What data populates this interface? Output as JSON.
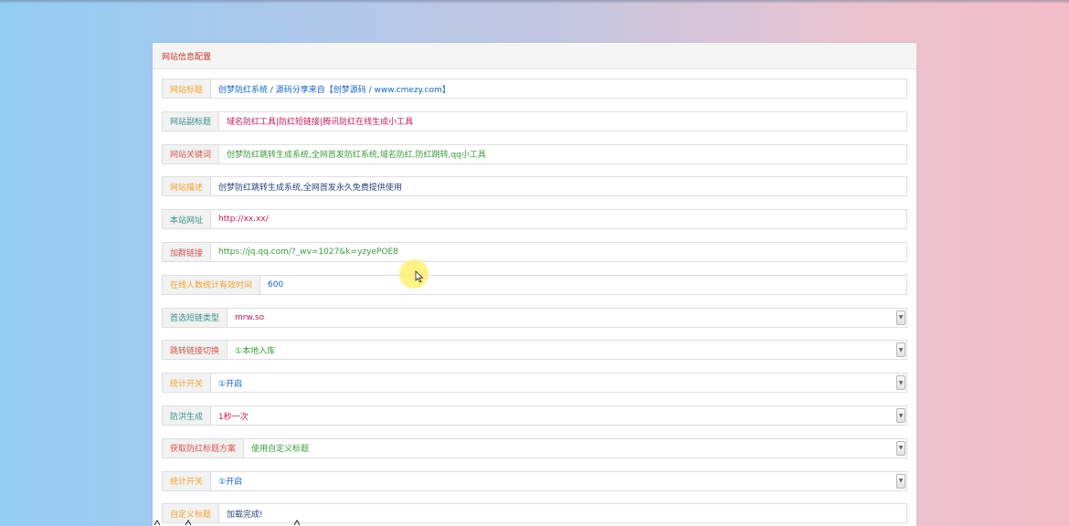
{
  "panel": {
    "title": "网站信息配置"
  },
  "colors": {
    "title_red": "#c9302c",
    "orange": "#f0a030",
    "teal": "#3a8f8a",
    "red": "#d9534f",
    "blue": "#1565c0",
    "green": "#3c9a3c",
    "magenta": "#c2185b",
    "cursor_highlight": "#fff06e"
  },
  "rows": [
    {
      "label": "网站标题",
      "value": "创梦防红系统 / 源码分享来自【创梦源码 / www.cmezy.com】",
      "label_color": "#f0a030",
      "value_color": "#1565c0",
      "type": "input"
    },
    {
      "label": "网站副标题",
      "value": "域名防红工具|防红短链接|腾讯防红在线生成小工具",
      "label_color": "#3a8f8a",
      "value_color": "#c2185b",
      "type": "input"
    },
    {
      "label": "网站关键词",
      "value": "创梦防红跳转生成系统,全网首发防红系统,域名防红,防红跳转,qq小工具",
      "label_color": "#d9534f",
      "value_color": "#3c9a3c",
      "type": "input"
    },
    {
      "label": "网站描述",
      "value": "创梦防红跳转生成系统,全网首发永久免费提供使用",
      "label_color": "#f0a030",
      "value_color": "#2a3f7a",
      "type": "input"
    },
    {
      "label": "本站网址",
      "value": "http://xx.xx/",
      "label_color": "#3a8f8a",
      "value_color": "#c2185b",
      "type": "input"
    },
    {
      "label": "加群链接",
      "value": "https://jq.qq.com/?_wv=1027&k=yzyePOE8",
      "label_color": "#d9534f",
      "value_color": "#3c9a3c",
      "type": "input"
    },
    {
      "label": "在线人数统计有效时间",
      "value": "600",
      "label_color": "#f0a030",
      "value_color": "#1565c0",
      "type": "input"
    },
    {
      "label": "首选短链类型",
      "value": "mrw.so",
      "label_color": "#3a8f8a",
      "value_color": "#c2185b",
      "type": "select"
    },
    {
      "label": "跳转链接切换",
      "value": "①本地入库",
      "label_color": "#d9534f",
      "value_color": "#3c9a3c",
      "type": "select"
    },
    {
      "label": "统计开关",
      "value": "①开启",
      "label_color": "#f0a030",
      "value_color": "#1565c0",
      "type": "select"
    },
    {
      "label": "防洪生成",
      "value": "1秒一次",
      "label_color": "#3a8f8a",
      "value_color": "#c2185b",
      "type": "select"
    },
    {
      "label": "获取防红标题方案",
      "value": "使用自定义标题",
      "label_color": "#d9534f",
      "value_color": "#3c9a3c",
      "type": "select"
    },
    {
      "label": "统计开关",
      "value": "①开启",
      "label_color": "#f0a030",
      "value_color": "#1565c0",
      "type": "select"
    },
    {
      "label": "自定义标题",
      "value": "加载完成!",
      "label_color": "#f0a030",
      "value_color": "#2a3f7a",
      "type": "input"
    }
  ]
}
